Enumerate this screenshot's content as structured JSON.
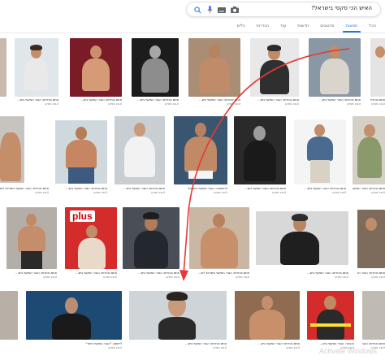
{
  "search": {
    "query": "האיש הכי סקסי בישראל?"
  },
  "tabs": [
    {
      "label": "הכל",
      "active": false
    },
    {
      "label": "תמונות",
      "active": true
    },
    {
      "label": "סרטונים",
      "active": false
    },
    {
      "label": "חדשות",
      "active": false
    },
    {
      "label": "עוד",
      "active": false
    },
    {
      "label": "הגדרות",
      "active": false
    },
    {
      "label": "כלים",
      "active": false
    }
  ],
  "rows": [
    {
      "tiles": [
        {
          "title": "אתם בוחרים: הגבר הסקסי ביש...",
          "source": "co.il מאקו"
        },
        {
          "title": "אתם בוחרים: הגבר הסקסי ביש...",
          "source": "co.il מאקו"
        },
        {
          "title": "אתם בוחרים: הגבר הסקסי ביש...",
          "source": "co.il מאקו"
        },
        {
          "title": "אתם בוחרים: הגבר הסקסי ביש...",
          "source": "co.il מאקו"
        },
        {
          "title": "אתם בוחרים: הגבר הסקסי ביש...",
          "source": "co.il מאקו"
        },
        {
          "title": "אתם בוחרים: הגבר הסקסי ביש...",
          "source": "co.il מאקו"
        },
        {
          "title": "אתם בוחרים: הגבר הסקסי ביש...",
          "source": "co.il מאקו"
        }
      ]
    },
    {
      "tiles": [
        {
          "title": "אתם בוחרים: הגבר הסקסי בישראל לשנת 2019",
          "source": "co.il מאקו"
        },
        {
          "title": "אתם בוחרים: הגבר הסקסי ביש...",
          "source": "co.il מאקו"
        },
        {
          "title": "אתם בוחרים: הגבר הסקסי ביש...",
          "source": "co.il מאקו"
        },
        {
          "title": "לראשונה: הגבר הסקסי בישראל",
          "source": "co.il מאקו"
        },
        {
          "title": "אתם בוחרים: הגבר הסקסי ביש...",
          "source": "co.il מאקו"
        },
        {
          "title": "אתם בוחרים: הגבר הסקסי ביש...",
          "source": "co.il מאקו"
        },
        {
          "title": "אתם בוחרים: הגבר הסקסי ביש...",
          "source": "co.il מאקו"
        }
      ]
    },
    {
      "tiles": [
        {
          "title": "אתם בוחרים: הגבר הסקסי ביש...",
          "source": "co.il מאקו"
        },
        {
          "title": "אתם בוחרים: הגבר הסקסי ביש...",
          "source": "co.il מאקו"
        },
        {
          "title": "אתם בוחרים: הגבר הסקסי ביש...",
          "source": "co.il מאקו"
        },
        {
          "title": "אתם בוחרים: הגבר הסקסי בישראל לש...",
          "source": "co.il מאקו"
        },
        {
          "title": "אתם בוחרים: הגבר הסקסי ביש...",
          "source": "co.il מאקו"
        },
        {
          "title": "אתם בוחרים: הגבר הסקסי ביש...",
          "source": "co.il מאקו"
        }
      ]
    },
    {
      "tiles": [
        {
          "title": "לייטסון: \"הגבר הסקסי ביותר\"",
          "source": "co.il מאקו"
        },
        {
          "title": "אתם בוחרים: הגבר הסקסי ביש...",
          "source": "co.il מאקו"
        },
        {
          "title": "אתם בוחרים: הגבר הסקסי ביש...",
          "source": "co.il מאקו"
        },
        {
          "title": "הנבחר: הגבר הסקסי ביש...",
          "source": "co.il מאקו"
        },
        {
          "title": "אתם בוחרים: הגבר הסקסי ביש...",
          "source": "co.il מאקו"
        }
      ]
    }
  ],
  "badges": {
    "plus_label": "plus"
  },
  "watermark": "Activate Windows",
  "colors": {
    "accent": "#1a73e8",
    "arrow": "#e53935"
  }
}
